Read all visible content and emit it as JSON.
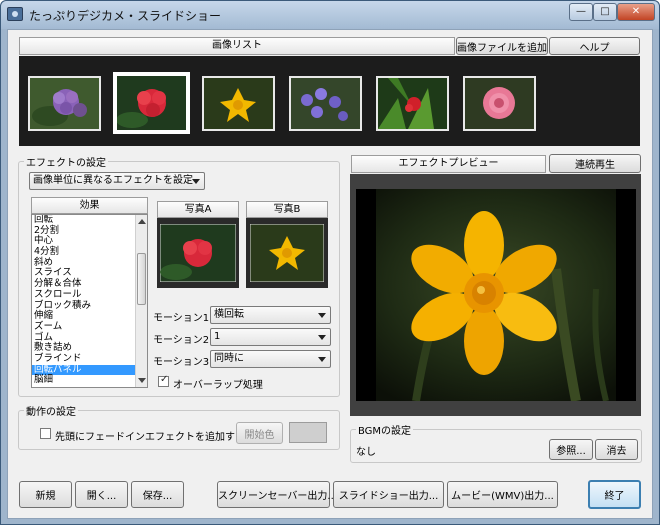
{
  "window": {
    "title": "たっぷりデジカメ・スライドショー",
    "min_glyph": "—",
    "max_glyph": "□",
    "close_glyph": "✕"
  },
  "image_list": {
    "header": "画像リスト",
    "add_button": "画像ファイルを追加",
    "help_button": "ヘルプ",
    "thumbnails": [
      {
        "subject": "purple-hydrangea",
        "selected": false
      },
      {
        "subject": "red-geranium",
        "selected": true
      },
      {
        "subject": "yellow-daffodil",
        "selected": false
      },
      {
        "subject": "purple-flowers",
        "selected": false
      },
      {
        "subject": "red-flower-leaves",
        "selected": false
      },
      {
        "subject": "pink-peony",
        "selected": false
      }
    ]
  },
  "effect_settings": {
    "group_label": "エフェクトの設定",
    "mode_select": "画像単位に異なるエフェクトを設定",
    "effects_header": "効果",
    "effects": [
      "回転",
      "2分割",
      "中心",
      "4分割",
      "斜め",
      "スライス",
      "分解＆合体",
      "スクロール",
      "ブロック積み",
      "伸縮",
      "ズーム",
      "ゴム",
      "敷き詰め",
      "ブラインド",
      "回転パネル",
      "脳細"
    ],
    "selected_effect_index": 14,
    "photo_a_label": "写真A",
    "photo_b_label": "写真B",
    "motion1_label": "モーション1",
    "motion1_value": "横回転",
    "motion2_label": "モーション2",
    "motion2_value": "1",
    "motion3_label": "モーション3",
    "motion3_value": "同時に",
    "overlap_label": "オーバーラップ処理",
    "overlap_checked": true
  },
  "preview": {
    "header": "エフェクトプレビュー",
    "play_button": "連続再生"
  },
  "action_settings": {
    "group_label": "動作の設定",
    "fadein_label": "先頭にフェードインエフェクトを追加する",
    "fadein_checked": false,
    "start_color_button": "開始色"
  },
  "bgm": {
    "group_label": "BGMの設定",
    "value": "なし",
    "browse_button": "参照...",
    "clear_button": "消去"
  },
  "footer": {
    "new_button": "新規",
    "open_button": "開く...",
    "save_button": "保存...",
    "screensaver_button": "スクリーンセーバー出力...",
    "slideshow_button": "スライドショー出力...",
    "movie_button": "ムービー(WMV)出力...",
    "exit_button": "終了"
  }
}
